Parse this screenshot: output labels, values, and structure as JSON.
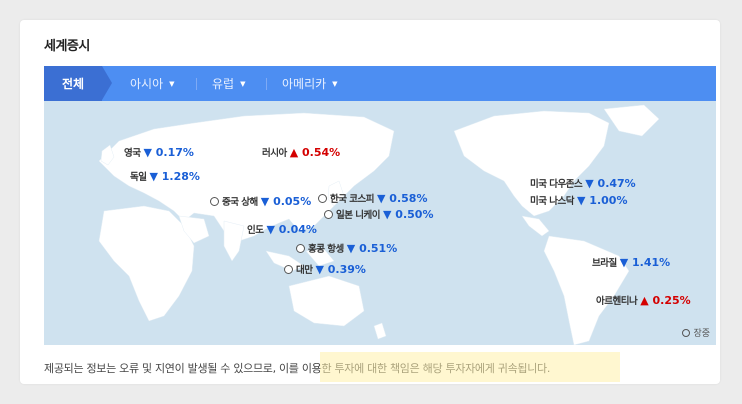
{
  "section": {
    "title": "세계증시"
  },
  "tabs": [
    {
      "label": "전체",
      "active": true
    },
    {
      "label": "아시아"
    },
    {
      "label": "유럽"
    },
    {
      "label": "아메리카"
    }
  ],
  "markets": [
    {
      "name": "영국",
      "change": "▼ 0.17%",
      "direction": "down",
      "clock": false
    },
    {
      "name": "러시아",
      "change": "▲ 0.54%",
      "direction": "up",
      "clock": false
    },
    {
      "name": "독일",
      "change": "▼ 1.28%",
      "direction": "down",
      "clock": false
    },
    {
      "name": "중국 상해",
      "change": "▼ 0.05%",
      "direction": "down",
      "clock": true
    },
    {
      "name": "한국 코스피",
      "change": "▼ 0.58%",
      "direction": "down",
      "clock": true
    },
    {
      "name": "일본 니케이",
      "change": "▼ 0.50%",
      "direction": "down",
      "clock": true
    },
    {
      "name": "인도",
      "change": "▼ 0.04%",
      "direction": "down",
      "clock": true
    },
    {
      "name": "홍콩 항셍",
      "change": "▼ 0.51%",
      "direction": "down",
      "clock": true
    },
    {
      "name": "대만",
      "change": "▼ 0.39%",
      "direction": "down",
      "clock": true
    },
    {
      "name": "미국 다우존스",
      "change": "▼ 0.47%",
      "direction": "down",
      "clock": false
    },
    {
      "name": "미국 나스닥",
      "change": "▼ 1.00%",
      "direction": "down",
      "clock": false
    },
    {
      "name": "브라질",
      "change": "▼ 1.41%",
      "direction": "down",
      "clock": false
    },
    {
      "name": "아르헨티나",
      "change": "▲ 0.25%",
      "direction": "up",
      "clock": false
    }
  ],
  "legend": {
    "label": "장중"
  },
  "disclaimer": "제공되는 정보는 오류 및 지연이 발생될 수 있으므로, 이를 이용한 투자에 대한 책임은 해당 투자자에게 귀속됩니다.",
  "colors": {
    "up": "#d40000",
    "down": "#1a5fd6",
    "tab_bar": "#4d8ef2",
    "map_sea": "#cfe2ef",
    "map_land": "#ffffff"
  }
}
